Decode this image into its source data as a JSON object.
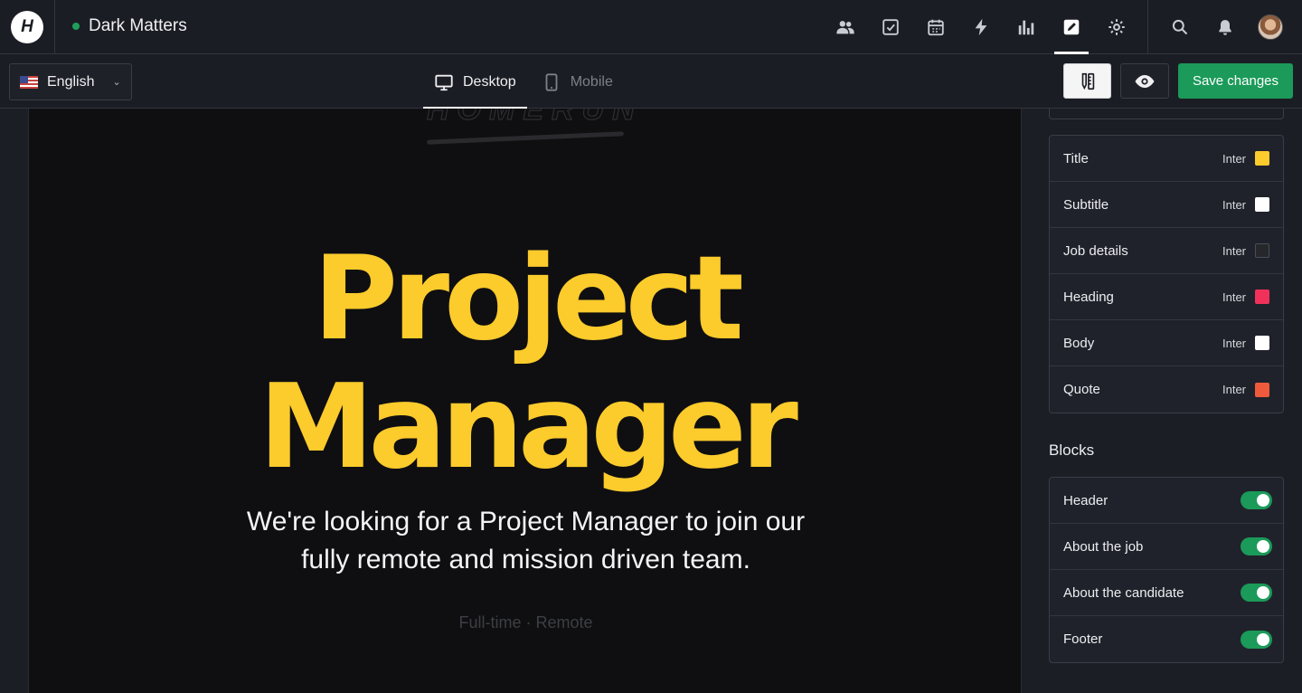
{
  "app": {
    "logo_letter": "H",
    "company_name": "Dark Matters",
    "status_color": "#1e9e5a"
  },
  "nav": {
    "icons": [
      "people-icon",
      "checkbox-icon",
      "calendar-icon",
      "lightning-icon",
      "bar-chart-icon",
      "pencil-icon",
      "gear-icon"
    ],
    "active": "pencil-icon",
    "right_icons": [
      "search-icon",
      "bell-icon",
      "avatar"
    ]
  },
  "toolbar": {
    "language": "English",
    "device_tabs": [
      {
        "label": "Desktop",
        "icon": "desktop-icon",
        "active": true
      },
      {
        "label": "Mobile",
        "icon": "mobile-icon",
        "active": false
      }
    ],
    "save_label": "Save changes",
    "save_color": "#1b9a59"
  },
  "preview": {
    "brand_text": "HOMERUN",
    "job_title_line1": "Project",
    "job_title_line2": "Manager",
    "job_title_color": "#fccb2c",
    "intro_line1": "We're looking for a Project Manager to join our",
    "intro_line2": "fully remote and mission driven team.",
    "meta": "Full-time · Remote"
  },
  "typography": {
    "items": [
      {
        "label": "Title",
        "font": "Inter",
        "color": "#fccb2c"
      },
      {
        "label": "Subtitle",
        "font": "Inter",
        "color": "#ffffff"
      },
      {
        "label": "Job details",
        "font": "Inter",
        "color": "#26272b"
      },
      {
        "label": "Heading",
        "font": "Inter",
        "color": "#f0325a"
      },
      {
        "label": "Body",
        "font": "Inter",
        "color": "#ffffff"
      },
      {
        "label": "Quote",
        "font": "Inter",
        "color": "#f05a3c"
      }
    ]
  },
  "blocks": {
    "title": "Blocks",
    "items": [
      {
        "label": "Header",
        "enabled": true
      },
      {
        "label": "About the job",
        "enabled": true
      },
      {
        "label": "About the candidate",
        "enabled": true
      },
      {
        "label": "Footer",
        "enabled": true
      }
    ]
  }
}
